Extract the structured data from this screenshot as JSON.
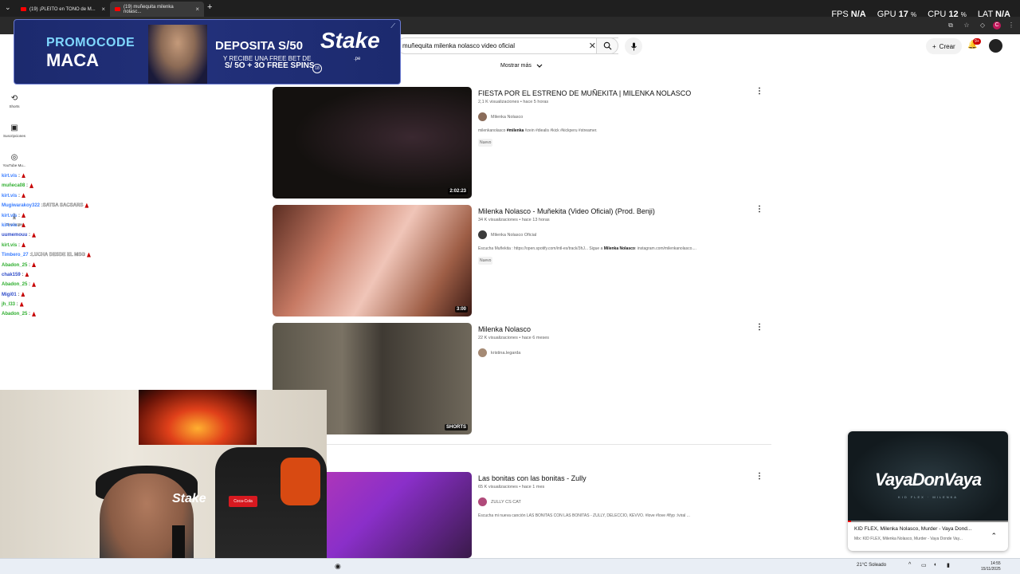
{
  "tabs": [
    {
      "label": "(19) ¡PLEITO en TONO de M..."
    },
    {
      "label": "(19) muñequita milenka nolasc..."
    }
  ],
  "overlay_stats": {
    "fps_label": "FPS",
    "fps_value": "N/A",
    "gpu_label": "GPU",
    "gpu_value": "17",
    "gpu_unit": "%",
    "cpu_label": "CPU",
    "cpu_value": "12",
    "cpu_unit": "%",
    "lat_label": "LAT",
    "lat_value": "N/A"
  },
  "search": {
    "query": "muñequita milenka nolasco video oficial",
    "clear_icon": "✕"
  },
  "header": {
    "create_label": "Crear",
    "notif_badge": "9+"
  },
  "sidebar": {
    "items": [
      {
        "label": "Shorts"
      },
      {
        "label": "Suscripciones"
      },
      {
        "label": "YouTube Mu..."
      },
      {
        "label": "Descargas"
      }
    ]
  },
  "ad": {
    "promo_line1": "PROMOCODE",
    "promo_line2": "MACA",
    "deposit": "DEPOSITA S/50",
    "free_line1": "Y RECIBE UNA FREE BET DE",
    "free_line2": "S/ 5O + 3O FREE SPINS",
    "brand": "Stake",
    "brand_sub": ".pe",
    "age": "18"
  },
  "chat": [
    {
      "user": "kirt.vis",
      "color": "#3a7dff",
      "msg": ""
    },
    {
      "user": "muñeca08",
      "color": "#2fae2f",
      "msg": ""
    },
    {
      "user": "kirt.vis",
      "color": "#3a7dff",
      "msg": ""
    },
    {
      "user": "Mugiwarakoy322",
      "color": "#3a7dff",
      "msg": "SATSA SACSARS"
    },
    {
      "user": "kirt.vis",
      "color": "#3a7dff",
      "msg": ""
    },
    {
      "user": "kirt.vis",
      "color": "#3a7dff",
      "msg": ""
    },
    {
      "user": "uumemouu",
      "color": "#2f4cc9",
      "msg": ""
    },
    {
      "user": "kirt.vis",
      "color": "#2fae2f",
      "msg": ""
    },
    {
      "user": "Timbero_27",
      "color": "#3a7dff",
      "msg": "LUCHA DESDE EL MSG"
    },
    {
      "user": "Abadon_25",
      "color": "#2fae2f",
      "msg": ""
    },
    {
      "user": "chak159",
      "color": "#2f4cc9",
      "msg": ""
    },
    {
      "user": "Abadon_25",
      "color": "#2fae2f",
      "msg": ""
    },
    {
      "user": "Migi01",
      "color": "#2f4cc9",
      "msg": ""
    },
    {
      "user": "jh_l33",
      "color": "#2fae2f",
      "msg": ""
    },
    {
      "user": "Abadon_25",
      "color": "#2fae2f",
      "msg": ""
    }
  ],
  "results_header": {
    "show_more": "Mostrar más"
  },
  "results": [
    {
      "title": "FIESTA POR EL ESTRENO DE MUÑEKITA | MILENKA NOLASCO",
      "stats": "2,1 K visualizaciones • hace 5 horas",
      "channel": "Milenka Nolasco",
      "desc_pre": "milenkanolasco ",
      "desc_bold": "#milenka",
      "desc_post": " #zein #diealis #kick #kickperu #streamer.",
      "badge": "Nuevo",
      "duration": "2:02:23"
    },
    {
      "title": "Milenka Nolasco - Muñekita (Video Oficial) (Prod. Benji)",
      "stats": "34 K visualizaciones • hace 13 horas",
      "channel": "Milenka Nolasco Oficial",
      "desc_pre": "Escucha Muñekita : https://open.spotify.com/intl-es/track/3hJ... Sigue a ",
      "desc_bold": "Milenka Nolasco",
      "desc_post": ": instagram.com/milenkanolasco....",
      "badge": "Nuevo",
      "duration": "3:00"
    },
    {
      "title": "Milenka Nolasco ",
      "stats": "22 K visualizaciones • hace 6 meses",
      "channel": "kristina.legarda",
      "desc_pre": "",
      "desc_bold": "",
      "desc_post": "",
      "badge": "",
      "duration": "SHORTS"
    },
    {
      "title": "Las bonitas con las bonitas - Zully",
      "stats": "65 K visualizaciones • hace 1 mes",
      "channel": "ZULLY CS CAT",
      "desc_pre": "Escucha mi nueva canción LAS BONITAS CON LAS BONITAS - ZULLY, DELECCIO, KEVVO. #love #love #lfyp :/viral ...",
      "desc_bold": "",
      "desc_post": "",
      "badge": "",
      "duration": ""
    }
  ],
  "webcam": {
    "poster_text": "PRAMASTICAZO",
    "shirt_logo": "Stake",
    "cola": "Coca-Cola"
  },
  "miniplayer": {
    "video_text": "VayaDonVaya",
    "sub_text": "KID FLEX · MILENKA",
    "title": "KID FLEX, Milenka Nolasco, Murder - Vaya Dond...",
    "desc": "Mix: KID FLEX, Milenka Nolasco, Murder - Vaya Donde Vay...",
    "progress": 0.02
  },
  "taskbar": {
    "weather": "21°C  Soleado",
    "time": "14:55",
    "date": "15/11/2025"
  }
}
